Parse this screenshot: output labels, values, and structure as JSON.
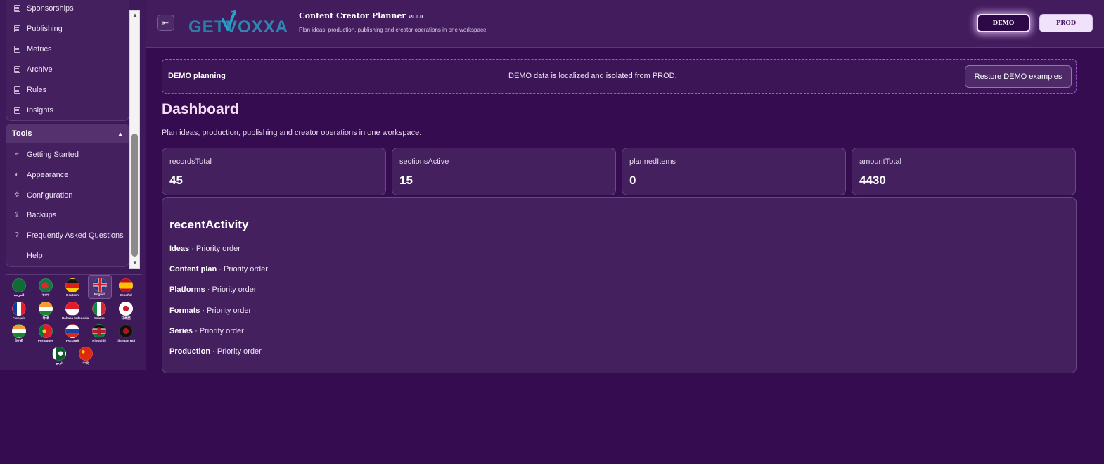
{
  "sidebar": {
    "items": [
      {
        "label": "Sponsorships",
        "icon": "document-icon"
      },
      {
        "label": "Publishing",
        "icon": "document-icon"
      },
      {
        "label": "Metrics",
        "icon": "document-icon"
      },
      {
        "label": "Archive",
        "icon": "document-icon"
      },
      {
        "label": "Rules",
        "icon": "document-icon"
      },
      {
        "label": "Insights",
        "icon": "document-icon"
      }
    ],
    "tools": {
      "heading": "Tools",
      "items": [
        {
          "label": "Getting Started",
          "icon": "cursor-icon"
        },
        {
          "label": "Appearance",
          "icon": "palette-icon"
        },
        {
          "label": "Configuration",
          "icon": "gear-icon"
        },
        {
          "label": "Backups",
          "icon": "upload-icon"
        },
        {
          "label": "Frequently Asked Questions",
          "icon": "question-icon"
        },
        {
          "label": "Help",
          "icon": ""
        }
      ]
    },
    "languages": [
      {
        "label": "العربية"
      },
      {
        "label": "বাংলা"
      },
      {
        "label": "Deutsch"
      },
      {
        "label": "English",
        "selected": true
      },
      {
        "label": "Español"
      },
      {
        "label": "Français"
      },
      {
        "label": "हिन्दी"
      },
      {
        "label": "Bahasa Indonesia"
      },
      {
        "label": "Italiano"
      },
      {
        "label": "日本語"
      },
      {
        "label": "ਪੰਜਾਬੀ"
      },
      {
        "label": "Português"
      },
      {
        "label": "Русский"
      },
      {
        "label": "Kiswahili"
      },
      {
        "label": "tlhIngan Hol"
      },
      {
        "label": "اردو"
      },
      {
        "label": "中文"
      }
    ]
  },
  "header": {
    "logo_get": "GET",
    "logo_voxxa": "VOXXA",
    "app_title": "Content Creator Planner",
    "version": "v9.0.0",
    "subtitle": "Plan ideas, production, publishing and creator operations in one workspace.",
    "demo_label": "DEMO",
    "prod_label": "PROD"
  },
  "banner": {
    "title": "DEMO planning",
    "message": "DEMO data is localized and isolated from PROD.",
    "restore_label": "Restore DEMO examples"
  },
  "main": {
    "title": "Dashboard",
    "subtitle": "Plan ideas, production, publishing and creator operations in one workspace.",
    "stats": [
      {
        "label": "recordsTotal",
        "value": "45"
      },
      {
        "label": "sectionsActive",
        "value": "15"
      },
      {
        "label": "plannedItems",
        "value": "0"
      },
      {
        "label": "amountTotal",
        "value": "4430"
      }
    ],
    "activity": {
      "title": "recentActivity",
      "rows": [
        {
          "name": "Ideas",
          "detail": " · Priority order"
        },
        {
          "name": "Content plan",
          "detail": " · Priority order"
        },
        {
          "name": "Platforms",
          "detail": " · Priority order"
        },
        {
          "name": "Formats",
          "detail": " · Priority order"
        },
        {
          "name": "Series",
          "detail": " · Priority order"
        },
        {
          "name": "Production",
          "detail": " · Priority order"
        }
      ]
    }
  }
}
